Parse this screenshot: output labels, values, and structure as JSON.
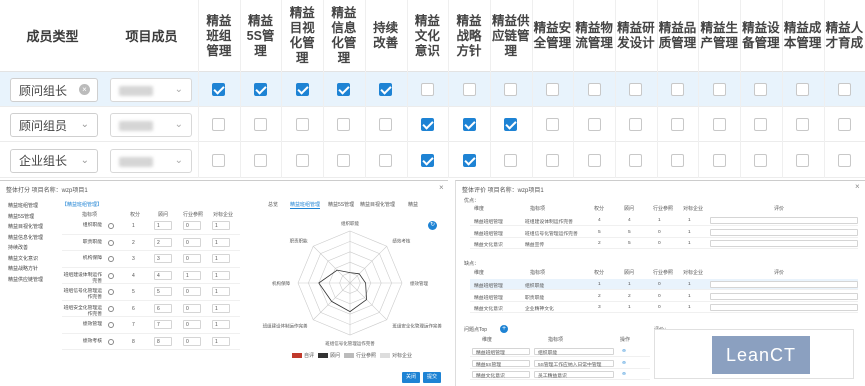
{
  "matrix": {
    "lead_headers": [
      "成员类型",
      "项目成员"
    ],
    "columns": [
      "精益\n班组\n管理",
      "精益\n5S管\n理",
      "精益\n目视\n化管\n理",
      "精益\n信息\n化管\n理",
      "持续\n改善",
      "精益\n文化\n意识",
      "精益\n战略\n方针",
      "精益供\n应链管\n理",
      "精益安\n全管理",
      "精益物\n流管理",
      "精益研\n发设计",
      "精益品\n质管理",
      "精益生\n产管理",
      "精益设\n备管理",
      "精益成\n本管理",
      "精益人\n才育成"
    ],
    "rows": [
      {
        "type": "顾问组长",
        "selected": true,
        "clearable": true,
        "checks": [
          1,
          1,
          1,
          1,
          1,
          0,
          0,
          0,
          0,
          0,
          0,
          0,
          0,
          0,
          0,
          0
        ]
      },
      {
        "type": "顾问组员",
        "selected": false,
        "clearable": false,
        "checks": [
          0,
          0,
          0,
          0,
          0,
          1,
          1,
          1,
          0,
          0,
          0,
          0,
          0,
          0,
          0,
          0
        ]
      },
      {
        "type": "企业组长",
        "selected": false,
        "clearable": false,
        "checks": [
          0,
          0,
          0,
          0,
          0,
          1,
          1,
          0,
          0,
          0,
          0,
          0,
          0,
          0,
          0,
          0
        ]
      }
    ]
  },
  "left_window": {
    "title": "整体打分    项目名称：wzp项目1",
    "nav": [
      "精益班组管理",
      "精益5S管理",
      "精益目视化管理",
      "精益信息化管理",
      "持续改善",
      "精益文化意识",
      "精益战略方针",
      "精益供应链管理"
    ],
    "active_tab": "【精益班组管理】",
    "table_headers": [
      "指标项",
      "",
      "权分",
      "顾问",
      "行业参照",
      "对标企业"
    ],
    "rows": [
      {
        "name": "组织职能",
        "w": "1",
        "v1": "1",
        "v2": "0",
        "v3": "1"
      },
      {
        "name": "职责职能",
        "w": "2",
        "v1": "2",
        "v2": "0",
        "v3": "1"
      },
      {
        "name": "机构保障",
        "w": "3",
        "v1": "3",
        "v2": "0",
        "v3": "1"
      },
      {
        "name": "班组建设体制运作完善",
        "w": "4",
        "v1": "4",
        "v2": "1",
        "v3": "1"
      },
      {
        "name": "班组信号化管理运作完善",
        "w": "5",
        "v1": "5",
        "v2": "0",
        "v3": "1"
      },
      {
        "name": "班组安全化管理运作完善",
        "w": "6",
        "v1": "6",
        "v2": "0",
        "v3": "1"
      },
      {
        "name": "绩效管理",
        "w": "7",
        "v1": "7",
        "v2": "0",
        "v3": "1"
      },
      {
        "name": "绩效考核",
        "w": "8",
        "v1": "8",
        "v2": "0",
        "v3": "1"
      }
    ],
    "radar_tabs": [
      "总览",
      "精益班组管理",
      "精益5S管理",
      "精益目视化管理",
      "精益"
    ],
    "radar_labels": [
      "组织职能",
      "绩效考核",
      "绩效管理",
      "班组安全化管理运作完善",
      "班组信号化管理运作完善",
      "班组建设体制运作完善",
      "机构保障",
      "职责职能"
    ],
    "radar_values": [
      0.2,
      0.25,
      0.3,
      0.45,
      0.55,
      0.5,
      0.6,
      0.35
    ],
    "legend": [
      "自评",
      "顾问",
      "行业参照",
      "对标企业"
    ],
    "buttons": [
      "关闭",
      "提交"
    ]
  },
  "right_window": {
    "title": "整体评价     项目名称：wzp项目1",
    "section1": "优点：",
    "section2": "缺点：",
    "section3": "问题点Top",
    "headers": [
      "维度",
      "指标项",
      "权分",
      "顾问",
      "行业参照",
      "对标企业",
      "评价"
    ],
    "strengths": [
      {
        "dim": "精益班组管理",
        "item": "班组建设体制运作完善",
        "w": "4",
        "v1": "4",
        "v2": "1",
        "v3": "1"
      },
      {
        "dim": "精益班组管理",
        "item": "班组信号化管理运作完善",
        "w": "5",
        "v1": "5",
        "v2": "0",
        "v3": "1"
      },
      {
        "dim": "精益文化意识",
        "item": "精益宣传",
        "w": "2",
        "v1": "5",
        "v2": "0",
        "v3": "1"
      }
    ],
    "weaknesses": [
      {
        "dim": "精益班组管理",
        "item": "组织职能",
        "w": "1",
        "v1": "1",
        "v2": "0",
        "v3": "1"
      },
      {
        "dim": "精益班组管理",
        "item": "职责职能",
        "w": "2",
        "v1": "2",
        "v2": "0",
        "v3": "1"
      },
      {
        "dim": "精益文化意识",
        "item": "企业精神文化",
        "w": "3",
        "v1": "1",
        "v2": "0",
        "v3": "1"
      }
    ],
    "problems": [
      {
        "dim": "精益班组管理",
        "item": "组织职能"
      },
      {
        "dim": "精益5S管理",
        "item": "5S管理工作应纳入日常中管理"
      },
      {
        "dim": "精益文化意识",
        "item": "员工精益意识"
      }
    ],
    "problem_headers": [
      "维度",
      "指标项",
      "操作"
    ],
    "eval_label": "评价：",
    "logo": "LeanCT"
  }
}
